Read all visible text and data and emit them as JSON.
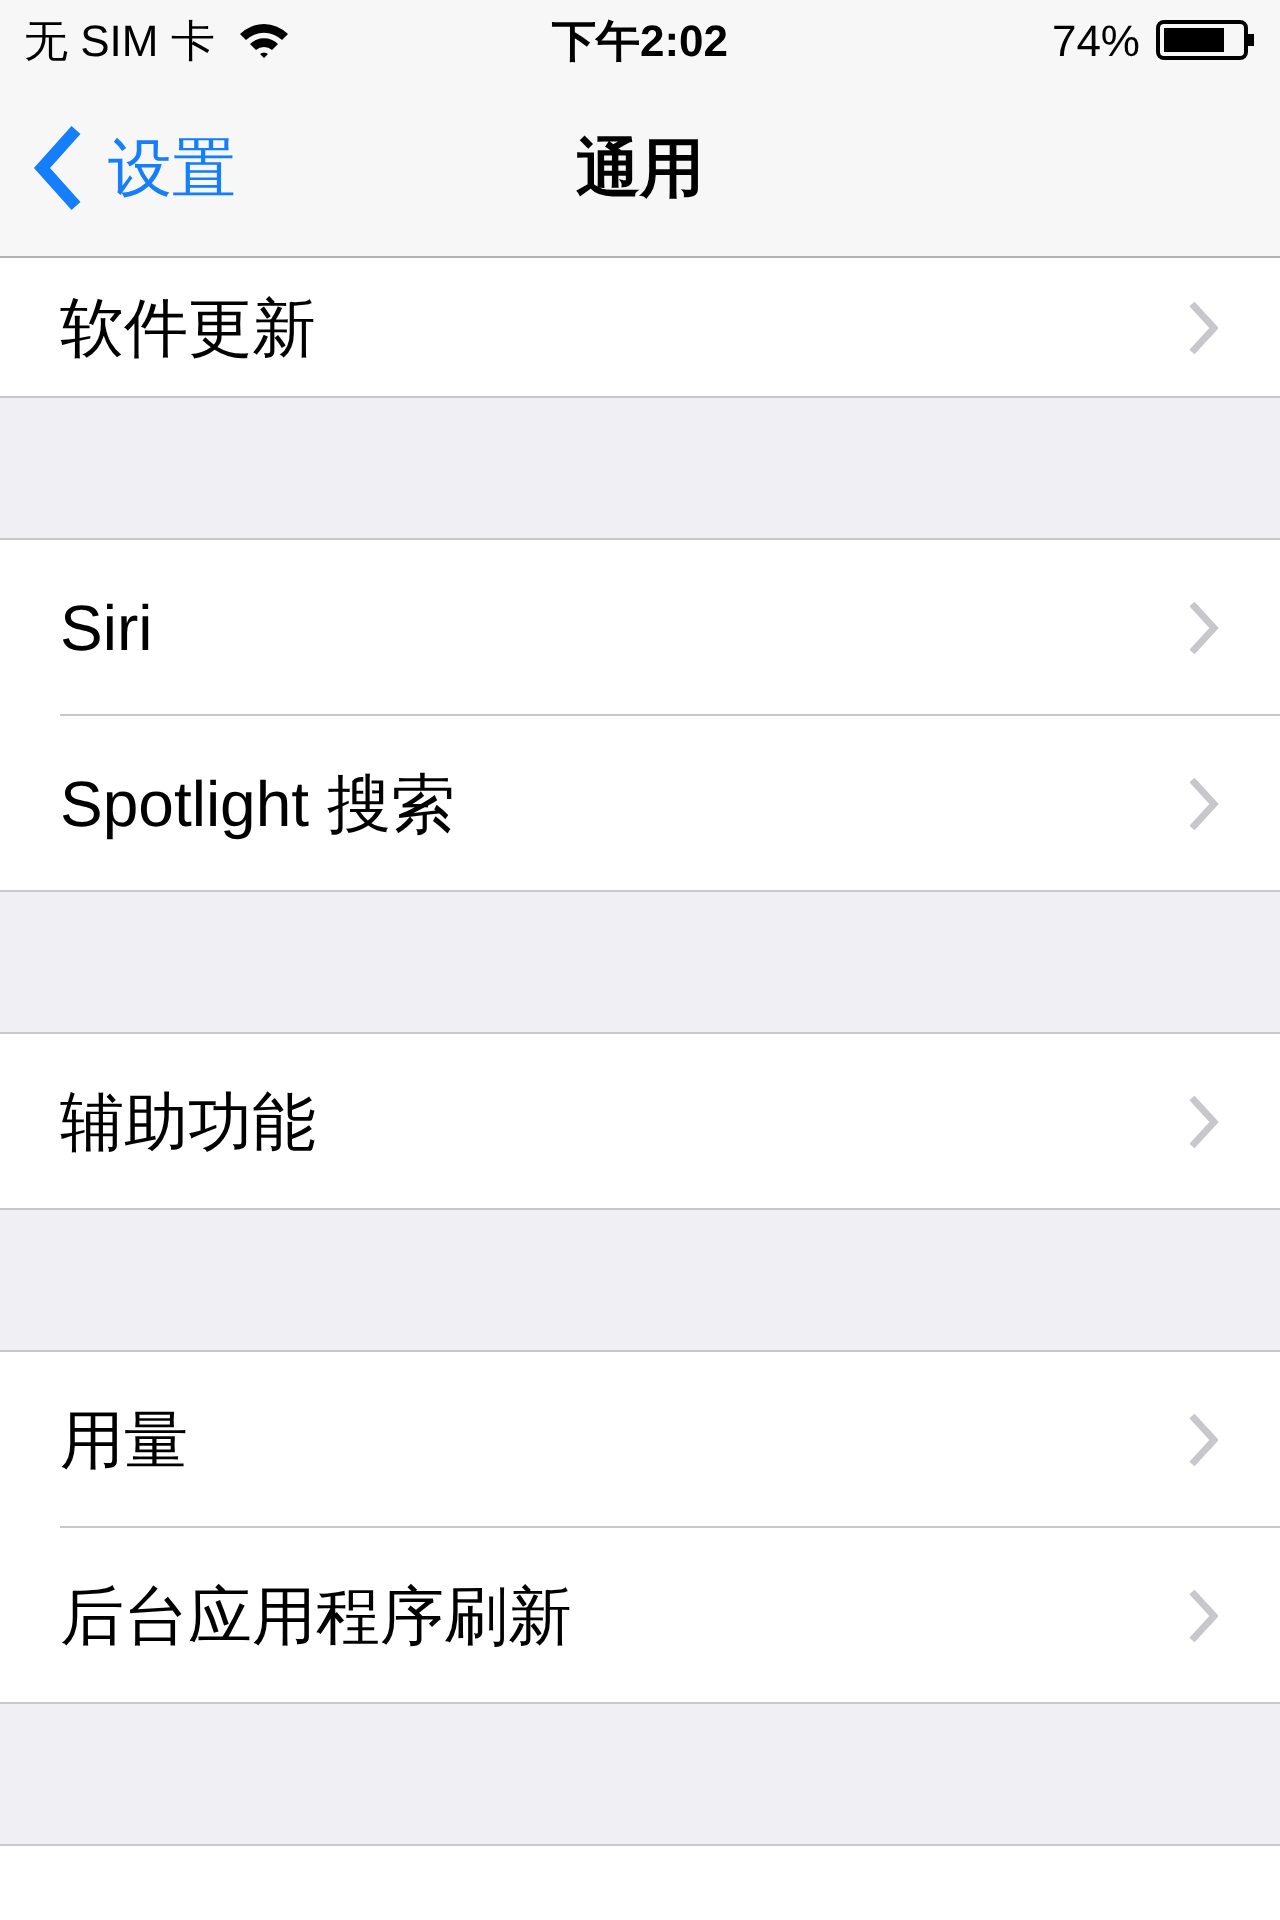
{
  "status_bar": {
    "carrier": "无 SIM 卡",
    "time": "下午2:02",
    "battery": "74%"
  },
  "nav_bar": {
    "back": "设置",
    "title": "通用"
  },
  "groups": [
    {
      "items": [
        {
          "label": "软件更新"
        }
      ]
    },
    {
      "items": [
        {
          "label": "Siri"
        },
        {
          "label": "Spotlight 搜索"
        }
      ]
    },
    {
      "items": [
        {
          "label": "辅助功能"
        }
      ]
    },
    {
      "items": [
        {
          "label": "用量"
        },
        {
          "label": "后台应用程序刷新"
        }
      ]
    }
  ]
}
